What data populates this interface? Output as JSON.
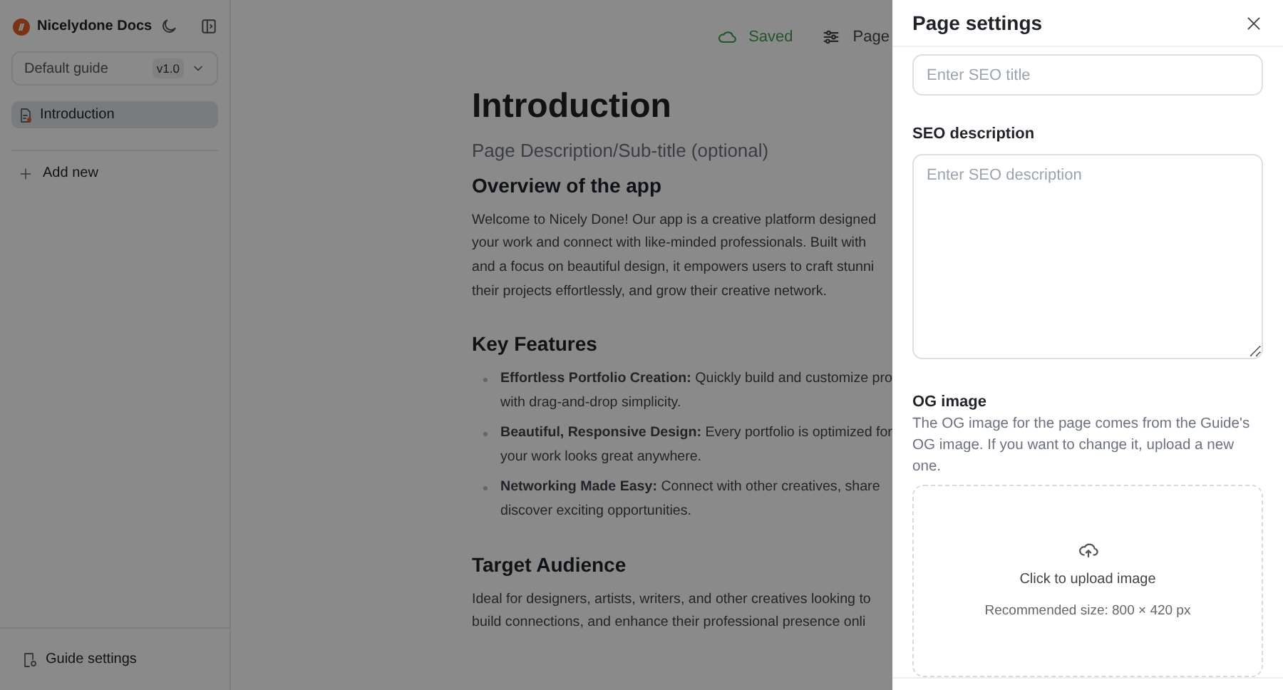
{
  "sidebar": {
    "brand": "Nicelydone Docs",
    "guide_select": {
      "value": "Default guide",
      "version": "v1.0"
    },
    "pages": [
      {
        "label": "Introduction",
        "selected": true
      }
    ],
    "add_new": "Add new",
    "footer_items": [
      "Guide settings"
    ]
  },
  "toolbar": {
    "status": "Saved",
    "page_button": "Page"
  },
  "document": {
    "title": "Introduction",
    "subtitle": "Page Description/Sub-title (optional)",
    "sections": [
      {
        "heading": "Overview of the app",
        "kind": "paragraph",
        "lines": [
          "Welcome to Nicely Done! Our app is a creative platform designed",
          "your work and connect with like-minded professionals. Built with",
          "and a focus on beautiful design, it empowers users to craft stunni",
          "their projects effortlessly, and grow their creative network."
        ]
      },
      {
        "heading": "Key Features",
        "kind": "list",
        "items": [
          {
            "lines": [
              "**Effortless Portfolio Creation:** Quickly build and customize pro",
              "with drag-and-drop simplicity."
            ]
          },
          {
            "lines": [
              "**Beautiful, Responsive Design:** Every portfolio is optimized for",
              "your work looks great anywhere."
            ]
          },
          {
            "lines": [
              "**Networking Made Easy:** Connect with other creatives, share",
              "discover exciting opportunities."
            ]
          }
        ]
      },
      {
        "heading": "Target Audience",
        "kind": "paragraph",
        "lines": [
          "Ideal for designers, artists, writers, and other creatives looking to",
          "build connections, and enhance their professional presence onli"
        ]
      }
    ]
  },
  "backdrop": true,
  "drawer": {
    "title": "Page settings",
    "seo_title": {
      "placeholder": "Enter SEO title"
    },
    "seo_description": {
      "label": "SEO description",
      "placeholder": "Enter SEO description"
    },
    "og_image": {
      "label": "OG image",
      "help": "The OG image for the page comes from the Guide's OG image. If you want to change it, upload a new one.",
      "upload_text": "Click to upload image",
      "size_hint": "Recommended size: 800 × 420 px"
    }
  }
}
